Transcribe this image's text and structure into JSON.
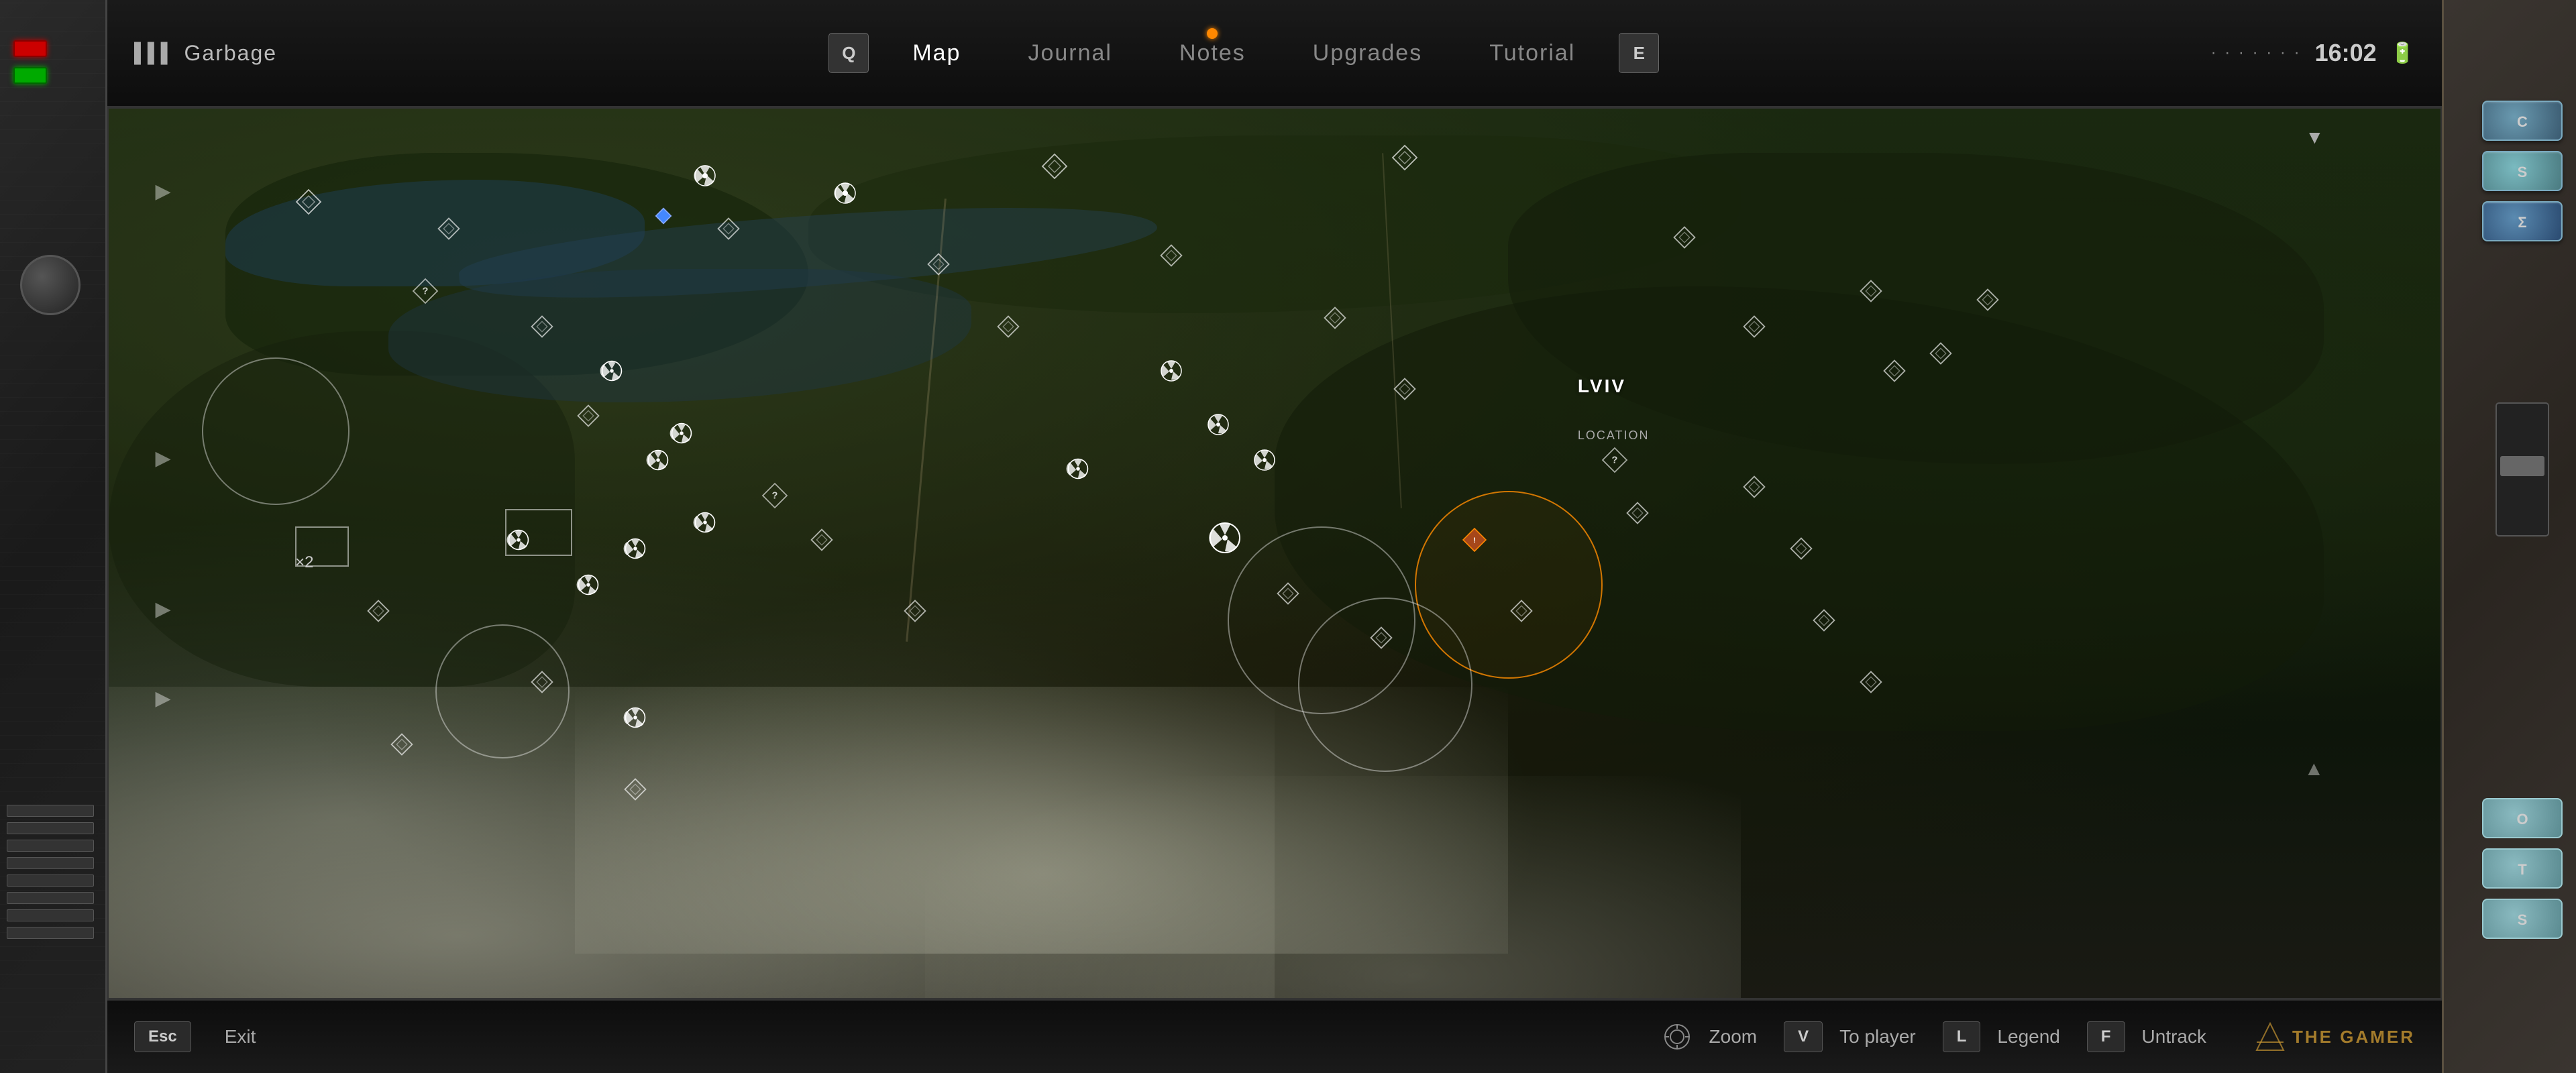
{
  "device": {
    "signal": "▌▌▌",
    "name": "Garbage",
    "time": "16:02",
    "battery": "🔋",
    "dots": "· · · · · · ·",
    "orange_dot_visible": true,
    "center_bar_label": "═══════"
  },
  "nav": {
    "left_key": "Q",
    "right_key": "E",
    "tabs": [
      {
        "label": "Map",
        "active": true
      },
      {
        "label": "Journal",
        "active": false
      },
      {
        "label": "Notes",
        "active": false
      },
      {
        "label": "Upgrades",
        "active": false
      },
      {
        "label": "Tutorial",
        "active": false
      }
    ]
  },
  "map": {
    "zoom_label": "×2",
    "location_name": "LVIV",
    "location_sub": "LOCATION"
  },
  "bottom_bar": {
    "esc_key": "Esc",
    "exit_label": "Exit",
    "zoom_label": "Zoom",
    "v_key": "V",
    "to_player_label": "To player",
    "l_key": "L",
    "legend_label": "Legend",
    "f_key": "F",
    "untrack_label": "Untrack"
  },
  "watermark": "THE GAMER",
  "icons": {
    "radiation": "☢",
    "question": "?",
    "diamond": "◇",
    "player": "◆",
    "unknown": "?"
  },
  "right_panel": {
    "buttons": [
      {
        "label": "C"
      },
      {
        "label": "S"
      },
      {
        "label": "Σ"
      },
      {
        "label": "O"
      },
      {
        "label": "T"
      },
      {
        "label": "S"
      }
    ]
  }
}
